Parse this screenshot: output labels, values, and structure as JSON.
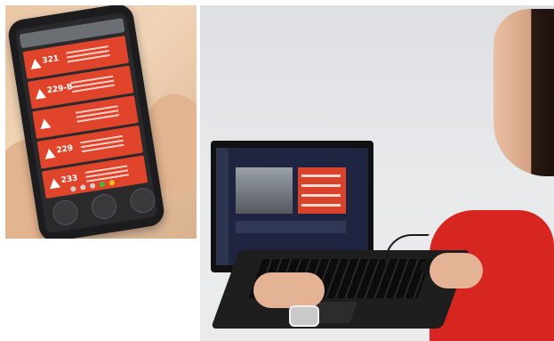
{
  "phone_photo": {
    "alert_cards": [
      {
        "number": "321"
      },
      {
        "number": "229-B"
      },
      {
        "number": ""
      },
      {
        "number": "229"
      },
      {
        "number": "233"
      }
    ],
    "status_dot_colors": [
      "#d0d0d0",
      "#d0d0d0",
      "#d0d0d0",
      "#3bbf3b",
      "#e8c21c",
      "#e0452b"
    ],
    "footer_buttons": [
      "bell-icon",
      "building-icon",
      "person-icon"
    ]
  },
  "laptop_photo": {
    "alert_row_count": 4,
    "colors": {
      "alert_red": "#d9432a",
      "shirt_red": "#d7261f"
    }
  }
}
